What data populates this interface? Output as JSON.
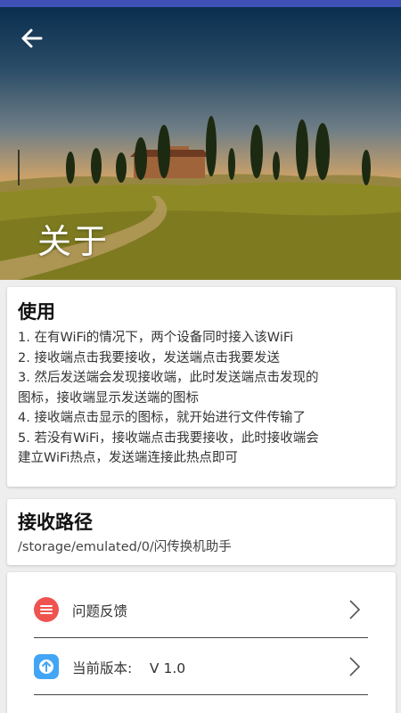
{
  "header": {
    "title": "关于",
    "back_icon": "arrow-left-icon",
    "colors": {
      "status_bar": "#3f51b5"
    }
  },
  "usage": {
    "title": "使用",
    "lines": [
      "1. 在有WiFi的情况下，两个设备同时接入该WiFi",
      "2. 接收端点击我要接收，发送端点击我要发送",
      "3. 然后发送端会发现接收端，此时发送端点击发现的",
      "图标，接收端显示发送端的图标",
      "4. 接收端点击显示的图标，就开始进行文件传输了",
      "5. 若没有WiFi，接收端点击我要接收，此时接收端会",
      "建立WiFi热点，发送端连接此热点即可"
    ]
  },
  "receive_path": {
    "title": "接收路径",
    "path": "/storage/emulated/0/闪传换机助手"
  },
  "menu": {
    "feedback": {
      "label": "问题反馈",
      "icon": "list-icon",
      "color": "#ef5350"
    },
    "version": {
      "label": "当前版本:    V 1.0",
      "icon": "upload-arrow-icon",
      "color": "#42a5f5"
    },
    "chevron_icon": "chevron-right-icon"
  }
}
